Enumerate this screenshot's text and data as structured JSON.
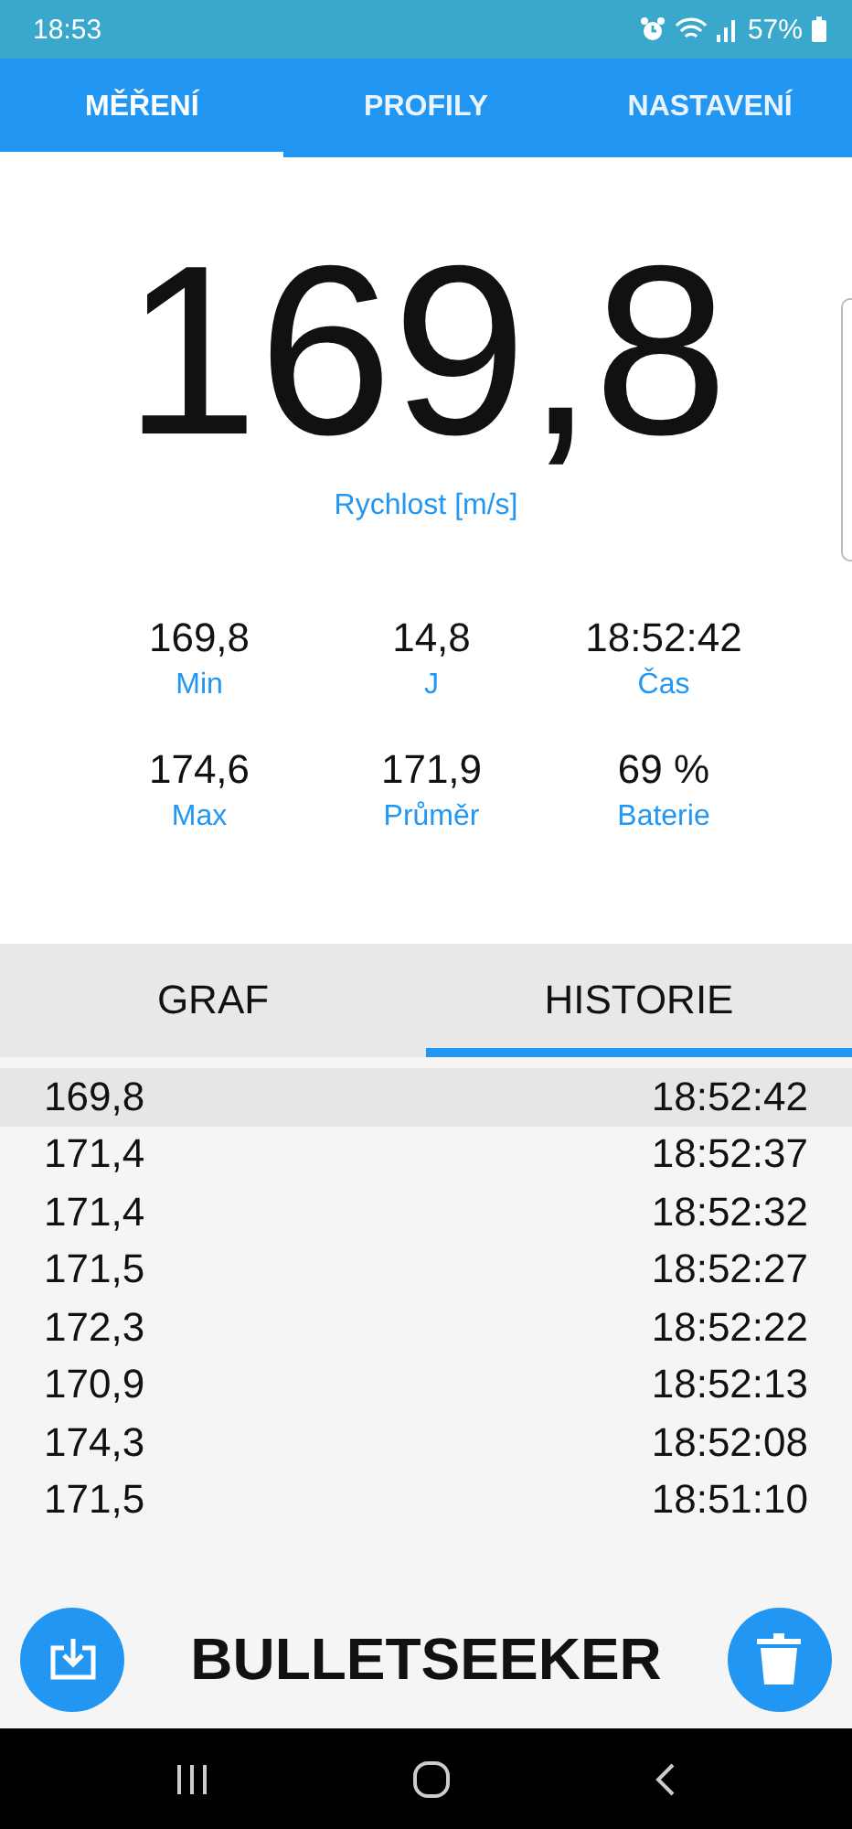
{
  "status_bar": {
    "time": "18:53",
    "battery": "57%"
  },
  "tabs": [
    {
      "label": "MĚŘENÍ",
      "selected": true
    },
    {
      "label": "PROFILY",
      "selected": false
    },
    {
      "label": "NASTAVENÍ",
      "selected": false
    }
  ],
  "reading": {
    "value": "169,8",
    "label": "Rychlost [m/s]"
  },
  "stats": [
    {
      "value": "169,8",
      "label": "Min"
    },
    {
      "value": "14,8",
      "label": "J"
    },
    {
      "value": "18:52:42",
      "label": "Čas"
    },
    {
      "value": "174,6",
      "label": "Max"
    },
    {
      "value": "171,9",
      "label": "Průměr"
    },
    {
      "value": "69 %",
      "label": "Baterie"
    }
  ],
  "subtabs": [
    {
      "label": "GRAF",
      "selected": false
    },
    {
      "label": "HISTORIE",
      "selected": true
    }
  ],
  "history": [
    {
      "speed": "169,8",
      "time": "18:52:42",
      "selected": true
    },
    {
      "speed": "171,4",
      "time": "18:52:37",
      "selected": false
    },
    {
      "speed": "171,4",
      "time": "18:52:32",
      "selected": false
    },
    {
      "speed": "171,5",
      "time": "18:52:27",
      "selected": false
    },
    {
      "speed": "172,3",
      "time": "18:52:22",
      "selected": false
    },
    {
      "speed": "170,9",
      "time": "18:52:13",
      "selected": false
    },
    {
      "speed": "174,3",
      "time": "18:52:08",
      "selected": false
    },
    {
      "speed": "171,5",
      "time": "18:51:10",
      "selected": false
    }
  ],
  "footer": {
    "title": "BULLETSEEKER"
  }
}
